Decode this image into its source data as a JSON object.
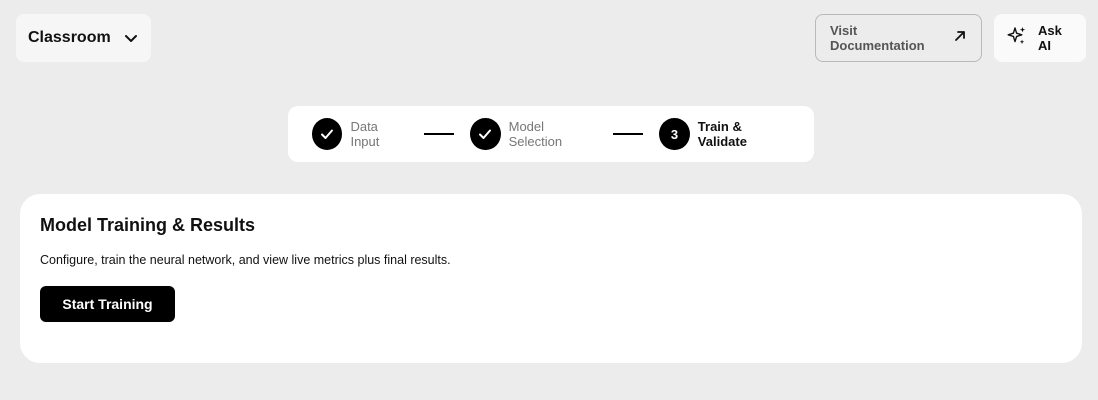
{
  "header": {
    "workspace": {
      "label": "Classroom",
      "icon": "chevron-down-icon"
    },
    "docs_button": {
      "label": "Visit Documentation",
      "icon": "arrow-up-right-icon"
    },
    "ask_button": {
      "label": "Ask AI",
      "icon": "sparkles-icon"
    }
  },
  "stepper": {
    "steps": [
      {
        "label": "Data Input",
        "status": "completed",
        "marker": ""
      },
      {
        "label": "Model Selection",
        "status": "completed",
        "marker": ""
      },
      {
        "label": "Train & Validate",
        "status": "current",
        "marker": "3"
      }
    ]
  },
  "card": {
    "title": "Model Training & Results",
    "description": "Configure, train the neural network, and view live metrics plus final results.",
    "primary_action": "Start Training"
  },
  "colors": {
    "background": "#ececec",
    "surface": "#ffffff",
    "primary": "#000000",
    "muted_text": "#777777"
  }
}
